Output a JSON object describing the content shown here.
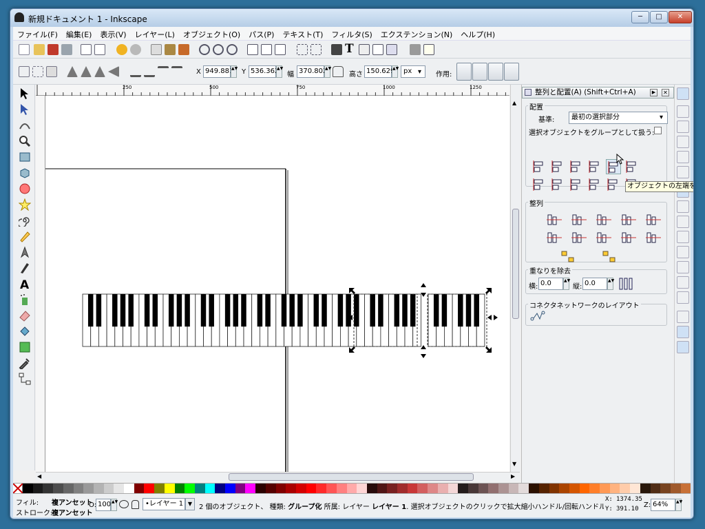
{
  "window": {
    "title": "新規ドキュメント 1 - Inkscape",
    "controls": [
      "─",
      "□",
      "✕"
    ]
  },
  "menu": [
    "ファイル(F)",
    "編集(E)",
    "表示(V)",
    "レイヤー(L)",
    "オブジェクト(O)",
    "パス(P)",
    "テキスト(T)",
    "フィルタ(S)",
    "エクステンション(N)",
    "ヘルプ(H)"
  ],
  "toolctrl": {
    "x_label": "X",
    "x_value": "949.881",
    "y_label": "Y",
    "y_value": "536.362",
    "w_label": "幅",
    "w_value": "370.802",
    "h_label": "高さ",
    "h_value": "150.629",
    "unit": "px",
    "affect_label": "作用:"
  },
  "ruler": {
    "ticks": [
      "250",
      "500",
      "750",
      "1000",
      "1250"
    ]
  },
  "dock": {
    "title": "整列と配置(A) (Shift+Ctrl+A)",
    "align_section": "配置",
    "relative_label": "基準:",
    "relative_value": "最初の選択部分",
    "group_checkbox_label": "選択オブジェクトをグループとして扱う:",
    "distribute_section": "整列",
    "overlap_section": "重なりを除去",
    "h_gap_label": "横:",
    "h_gap_value": "0.0",
    "v_gap_label": "縦:",
    "v_gap_value": "0.0",
    "connector_section": "コネクタネットワークのレイアウト"
  },
  "tooltip": "オブジェクトの左端を基準の",
  "status": {
    "fill_label": "フィル:",
    "fill_value": "複アンセット",
    "stroke_label": "ストローク:",
    "stroke_value": "複アンセット",
    "opacity_label": "O:",
    "opacity_value": "100",
    "layer": "•レイヤー 1",
    "message_1": "2 個のオブジェクト、 種類: ",
    "message_type": "グループ化",
    "message_2": " 所属: レイヤー ",
    "message_layer": "レイヤー 1",
    "message_3": ". 選択オブジェクトのクリックで拡大縮小ハンドル/回転ハンドルを切",
    "x_label": "X:",
    "x_value": "1374.35",
    "y_label": "Y:",
    "y_value": "391.10",
    "zoom_label": "Z:",
    "zoom_value": "64%"
  },
  "colors": {
    "accent": "#3a6ea5",
    "palette": [
      "#000000",
      "#1a1a1a",
      "#333333",
      "#4d4d4d",
      "#666666",
      "#808080",
      "#999999",
      "#b3b3b3",
      "#cccccc",
      "#e6e6e6",
      "#ffffff",
      "#800000",
      "#ff0000",
      "#808000",
      "#ffff00",
      "#008000",
      "#00ff00",
      "#008080",
      "#00ffff",
      "#000080",
      "#0000ff",
      "#800080",
      "#ff00ff",
      "#2b0000",
      "#550000",
      "#800000",
      "#aa0000",
      "#d40000",
      "#ff0000",
      "#ff2a2a",
      "#ff5555",
      "#ff8080",
      "#ffaaaa",
      "#ffd5d5",
      "#280b0b",
      "#501616",
      "#782121",
      "#a02c2c",
      "#c83737",
      "#d35f5f",
      "#de8787",
      "#e9afaf",
      "#f4d7d7",
      "#241c1c",
      "#483737",
      "#6c5353",
      "#916f6f",
      "#ac9393",
      "#c8b7b7",
      "#e3dbdb",
      "#2b1100",
      "#552200",
      "#803300",
      "#aa4400",
      "#d45500",
      "#ff6600",
      "#ff7f2a",
      "#ff9955",
      "#ffb380",
      "#ffccaa",
      "#ffe6d5",
      "#28170b",
      "#502d16",
      "#784421",
      "#a05a2c",
      "#c87137"
    ]
  }
}
